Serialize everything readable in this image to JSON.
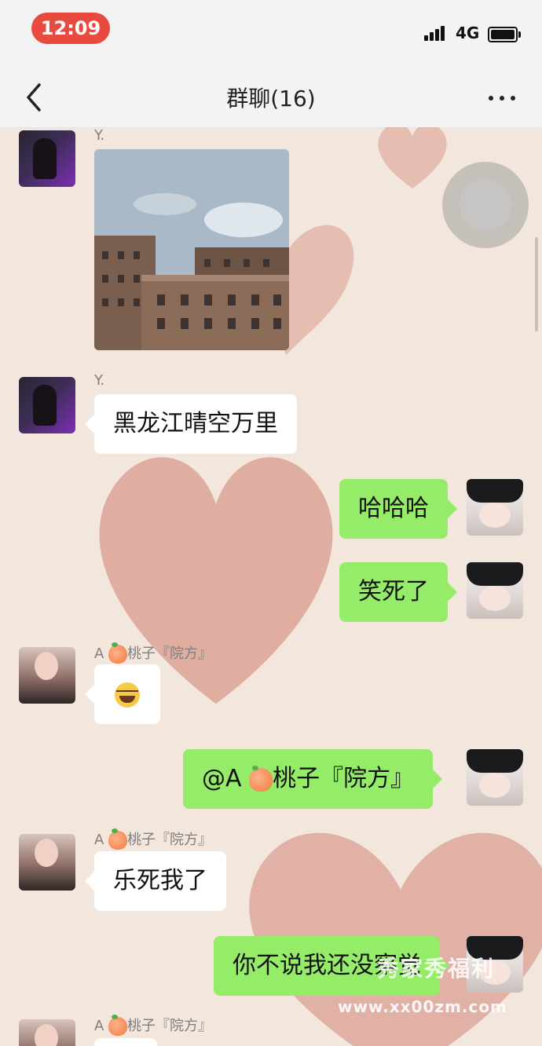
{
  "status_bar": {
    "time": "12:09",
    "network": "4G"
  },
  "nav": {
    "title": "群聊(16)"
  },
  "messages": [
    {
      "sender": "Y.",
      "type": "image",
      "side": "left"
    },
    {
      "sender": "Y.",
      "type": "text",
      "side": "left",
      "text": "黑龙江晴空万里"
    },
    {
      "sender": "",
      "type": "text",
      "side": "right",
      "text": "哈哈哈"
    },
    {
      "sender": "",
      "type": "text",
      "side": "right",
      "text": "笑死了"
    },
    {
      "sender_prefix": "A",
      "sender_suffix": "桃子『院方』",
      "type": "emoji",
      "side": "left",
      "emoji": "face-with-tears-of-joy"
    },
    {
      "sender": "",
      "type": "text",
      "side": "right",
      "text_prefix": "@A",
      "text_suffix": "桃子『院方』"
    },
    {
      "sender_prefix": "A",
      "sender_suffix": "桃子『院方』",
      "type": "text",
      "side": "left",
      "text": "乐死我了"
    },
    {
      "sender": "",
      "type": "text",
      "side": "right",
      "text": "你不说我还没察觉"
    },
    {
      "sender_prefix": "A",
      "sender_suffix": "桃子『院方』",
      "type": "text",
      "side": "left"
    }
  ],
  "watermark": {
    "line1": "秀家秀福利",
    "line2": "www.xx00zm.com"
  },
  "colors": {
    "time_pill": "#e84a3f",
    "bubble_me": "#95ec69",
    "bubble_other": "#ffffff",
    "background": "#f3e6dc",
    "heart": "#d99a8e"
  }
}
